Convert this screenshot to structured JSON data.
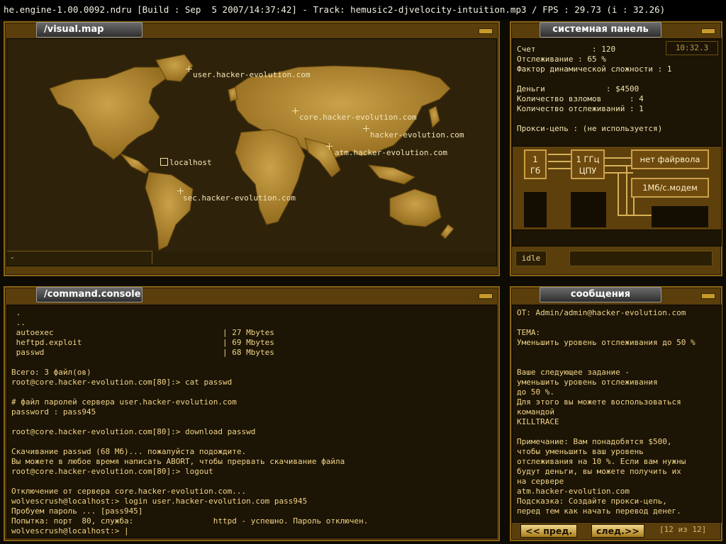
{
  "title_bar": "he.engine-1.00.0092.ndru [Build : Sep  5 2007/14:37:42] - Track: hemusic2-djvelocity-intuition.mp3 / FPS : 29.73 (i : 32.26)",
  "map": {
    "tab": "/visual.map",
    "status": "-",
    "servers": [
      {
        "label": "user.hacker-evolution.com"
      },
      {
        "label": "core.hacker-evolution.com"
      },
      {
        "label": "hacker-evolution.com"
      },
      {
        "label": "atm.hacker-evolution.com"
      },
      {
        "label": "localhost"
      },
      {
        "label": "sec.hacker-evolution.com"
      }
    ]
  },
  "system": {
    "tab": "системная панель",
    "clock": "10:32.3",
    "lines": [
      "Счет            : 120",
      "Отслеживание : 65 %",
      "Фактор динамической сложности : 1",
      "",
      "Деньги             : $4500",
      "Количество взломов      : 4",
      "Количество отслеживаний : 1",
      "",
      "Прокси-цепь : (не используется)"
    ],
    "ram_chip": [
      "1",
      "Гб"
    ],
    "cpu_chip": [
      "1 ГГц",
      "ЦПУ"
    ],
    "firewall": "нет файрвола",
    "modem": "1Мб/с.модем",
    "status": "idle"
  },
  "console": {
    "tab": "/command.console",
    "lines": [
      " .",
      " ..",
      " autoexec                                    | 27 Mbytes",
      " heftpd.exploit                              | 69 Mbytes",
      " passwd                                      | 68 Mbytes",
      "",
      "Всего: 3 файл(ов)",
      "root@core.hacker-evolution.com[80]:> cat passwd",
      "",
      "# файл паролей сервера user.hacker-evolution.com",
      "password : pass945",
      "",
      "root@core.hacker-evolution.com[80]:> download passwd",
      "",
      "Скачивание passwd (68 Мб)... пожалуйста подождите.",
      "Вы можете в любое время написать ABORT, чтобы прервать скачивание файла",
      "root@core.hacker-evolution.com[80]:> logout",
      "",
      "Отключение от сервера core.hacker-evolution.com...",
      "wolvescrush@localhost:> login user.hacker-evolution.com pass945",
      "Пробуем пароль ... [pass945]",
      "Попытка: порт  80, служба:                 httpd - успешно. Пароль отключен.",
      "wolvescrush@localhost:> |"
    ]
  },
  "messages": {
    "tab": "сообщения",
    "lines": [
      "ОТ: Admin/admin@hacker-evolution.com",
      "",
      "ТЕМА:",
      "Уменьшить уровень отслеживания до 50 %",
      "",
      "",
      "Ваше следующее задание -",
      "уменьшить уровень отслеживания",
      "до 50 %.",
      "Для этого вы можете воспользоваться",
      "командой",
      "KILLTRACE",
      "",
      "Примечание: Вам понадобятся $500,",
      "чтобы уменьшить ваш уровень",
      "отслеживания на 10 %. Если вам нужны",
      "будут деньги, вы можете получить их",
      "на сервере",
      "atm.hacker-evolution.com",
      "Подсказка: Создайте прокси-цепь,",
      "перед тем как начать перевод денег."
    ],
    "prev": "<< пред.",
    "next": "след.>>",
    "page": "[12 из 12]"
  }
}
